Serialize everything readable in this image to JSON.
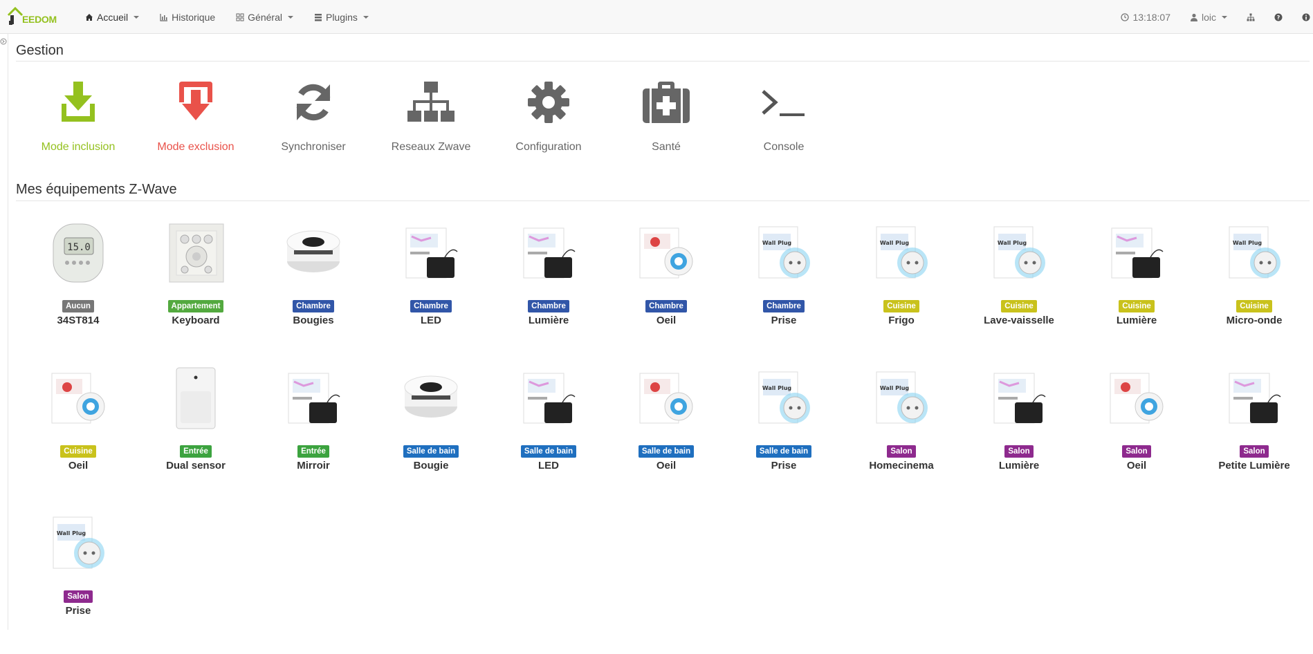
{
  "colors": {
    "green": "#94c11f",
    "red": "#e9524a",
    "grey_icon": "#666666",
    "badge_aucun": "#777777",
    "badge_appartement": "#53a93f",
    "badge_chambre": "#3156a8",
    "badge_cuisine": "#c9c21c",
    "badge_entree": "#3ca33f",
    "badge_sdb": "#1f6fbf",
    "badge_salon": "#8e2a8e"
  },
  "navbar": {
    "brand": "EEDOM",
    "items": [
      {
        "label": "Accueil",
        "icon": "home-icon"
      },
      {
        "label": "Historique",
        "icon": "bar-chart-icon"
      },
      {
        "label": "Général",
        "icon": "grid-icon"
      },
      {
        "label": "Plugins",
        "icon": "tasks-icon"
      }
    ],
    "time": "13:18:07",
    "user": "loic"
  },
  "gestion": {
    "title": "Gestion",
    "items": [
      {
        "label": "Mode inclusion",
        "icon": "download-icon"
      },
      {
        "label": "Mode exclusion",
        "icon": "upload-icon"
      },
      {
        "label": "Synchroniser",
        "icon": "refresh-icon"
      },
      {
        "label": "Reseaux Zwave",
        "icon": "network-icon"
      },
      {
        "label": "Configuration",
        "icon": "gear-icon"
      },
      {
        "label": "Santé",
        "icon": "medkit-icon"
      },
      {
        "label": "Console",
        "icon": "terminal-icon"
      }
    ]
  },
  "equipements": {
    "title": "Mes équipements Z-Wave",
    "items": [
      {
        "room": "Aucun",
        "name": "34ST814",
        "img": "thermostat"
      },
      {
        "room": "Appartement",
        "name": "Keyboard",
        "img": "keypad"
      },
      {
        "room": "Chambre",
        "name": "Bougies",
        "img": "ring"
      },
      {
        "room": "Chambre",
        "name": "LED",
        "img": "module"
      },
      {
        "room": "Chambre",
        "name": "Lumière",
        "img": "module"
      },
      {
        "room": "Chambre",
        "name": "Oeil",
        "img": "eye"
      },
      {
        "room": "Chambre",
        "name": "Prise",
        "img": "plug"
      },
      {
        "room": "Cuisine",
        "name": "Frigo",
        "img": "plug"
      },
      {
        "room": "Cuisine",
        "name": "Lave-vaisselle",
        "img": "plug"
      },
      {
        "room": "Cuisine",
        "name": "Lumière",
        "img": "module"
      },
      {
        "room": "Cuisine",
        "name": "Micro-onde",
        "img": "plug"
      },
      {
        "room": "Cuisine",
        "name": "Oeil",
        "img": "eye"
      },
      {
        "room": "Entrée",
        "name": "Dual sensor",
        "img": "pir"
      },
      {
        "room": "Entrée",
        "name": "Mirroir",
        "img": "module"
      },
      {
        "room": "Salle de bain",
        "name": "Bougie",
        "img": "ring"
      },
      {
        "room": "Salle de bain",
        "name": "LED",
        "img": "module"
      },
      {
        "room": "Salle de bain",
        "name": "Oeil",
        "img": "eye"
      },
      {
        "room": "Salle de bain",
        "name": "Prise",
        "img": "plug"
      },
      {
        "room": "Salon",
        "name": "Homecinema",
        "img": "plug"
      },
      {
        "room": "Salon",
        "name": "Lumière",
        "img": "module"
      },
      {
        "room": "Salon",
        "name": "Oeil",
        "img": "eye"
      },
      {
        "room": "Salon",
        "name": "Petite Lumière",
        "img": "module"
      },
      {
        "room": "Salon",
        "name": "Prise",
        "img": "plug"
      }
    ]
  }
}
